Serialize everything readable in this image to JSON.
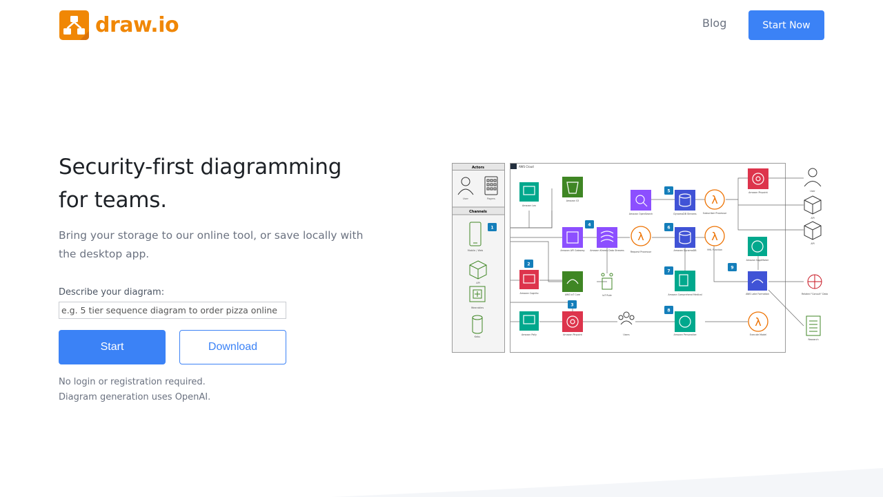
{
  "header": {
    "logo_text": "draw.io",
    "nav_blog": "Blog",
    "nav_start": "Start Now"
  },
  "hero": {
    "title_line1": "Security-first diagramming",
    "title_line2": "for teams.",
    "subtitle": "Bring your storage to our online tool, or save locally with the desktop app.",
    "describe_label": "Describe your diagram:",
    "describe_placeholder": "e.g. 5 tier sequence diagram to order pizza online",
    "describe_value": "",
    "start_button": "Start",
    "download_button": "Download",
    "note1": "No login or registration required.",
    "note2": "Diagram generation uses OpenAI."
  },
  "diagram": {
    "actors_title": "Actors",
    "channels_title": "Channels",
    "cloud_title": "AWS Cloud",
    "actors": [
      "User",
      "Pagers"
    ],
    "channels": [
      "Mobile / Web",
      "API",
      "Wearables",
      "Kebu"
    ],
    "badges": [
      "1",
      "2",
      "3",
      "4",
      "5",
      "6",
      "7",
      "8",
      "9"
    ],
    "services": {
      "lex": "Amazon Lex",
      "s3": "Amazon S3",
      "api_gateway": "Amazon API Gateway",
      "kinesis": "Amazon Kinesis Data Streams",
      "request_processor": "Request Processor",
      "dynamodb": "Amazon DynamoDB",
      "hhl_function": "HHL Function",
      "opensearch": "Amazon OpenSearch",
      "ddb_streams": "DynamoDB Streams",
      "subscriber": "Subscriber Processor",
      "pinpoint_top": "Amazon Pinpoint",
      "cognito": "Amazon Cognito",
      "iot_core": "AWS IoT Core",
      "iot_rule": "IoT Rule",
      "comprehend": "Amazon Comprehend Medical",
      "sagemaker": "Amazon SageMaker",
      "lake_formation": "AWS Lake Formation",
      "polly": "Amazon Polly",
      "pinpoint_bottom": "Amazon Pinpoint",
      "users": "Users",
      "personalize": "Amazon Personalize",
      "execute_model": "Execute Model"
    },
    "right_targets": [
      "User",
      "API",
      "API",
      "Related \"Consult\" Data",
      "Research"
    ]
  }
}
